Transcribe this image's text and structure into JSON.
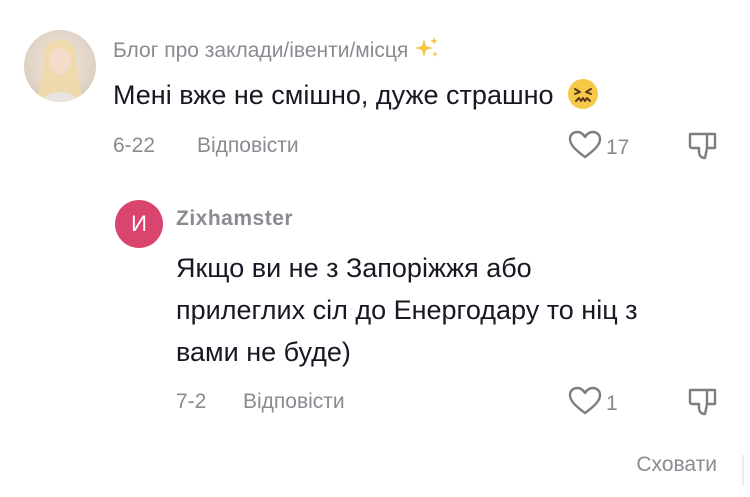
{
  "comments": [
    {
      "username": "Блог про заклади/івенти/місця",
      "username_emoji": "sparkles-icon",
      "text": "Мені вже не смішно, дуже страшно",
      "text_emoji": "confounded-face-icon",
      "date": "6-22",
      "reply_label": "Відповісти",
      "likes": "17"
    }
  ],
  "replies": [
    {
      "avatar_letter": "И",
      "username": "Zixhamster",
      "text_lines": [
        "Якщо ви не з Запоріжжя або",
        "прилеглих сіл до Енергодару то ніц з",
        "вами не буде)"
      ],
      "date": "7-2",
      "reply_label": "Відповісти",
      "likes": "1"
    }
  ],
  "hide_label": "Сховати",
  "colors": {
    "text": "#161823",
    "secondary": "#8a8b91",
    "avatar_bg": "#d9456f",
    "emoji_face": "#f7c948"
  }
}
